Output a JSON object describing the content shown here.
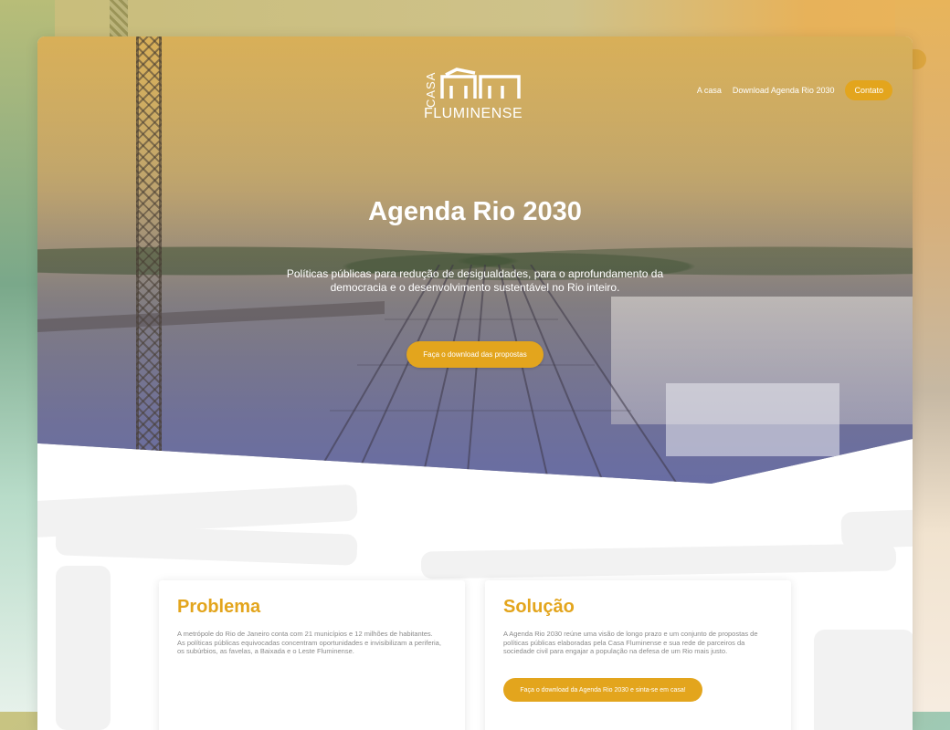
{
  "logo": {
    "casa": "CASA",
    "fluminense": "FLUMINENSE"
  },
  "nav": {
    "items": [
      "A casa",
      "Download Agenda Rio 2030"
    ],
    "contact": "Contato"
  },
  "hero": {
    "title": "Agenda Rio 2030",
    "subtitle": "Políticas públicas para redução de desigualdades, para o aprofundamento da democracia e o desenvolvimento sustentável no Rio inteiro.",
    "cta": "Faça o download das propostas"
  },
  "problem": {
    "title": "Problema",
    "text": "A metrópole do Rio de Janeiro conta com 21 municípios e 12 milhões de habitantes. As políticas públicas equivocadas concentram oportunidades e invisibilizam a periferia, os subúrbios, as favelas, a Baixada e o Leste Fluminense."
  },
  "solution": {
    "title": "Solução",
    "text": "A Agenda Rio 2030 reúne uma visão de longo prazo e um conjunto de propostas de políticas públicas elaboradas pela Casa Fluminense e sua rede de parceiros da sociedade civil para engajar a população na defesa de um Rio mais justo.",
    "cta": "Faça o download da Agenda Rio 2030 e sinta-se em casa!"
  },
  "colors": {
    "accent": "#e3a51d"
  }
}
